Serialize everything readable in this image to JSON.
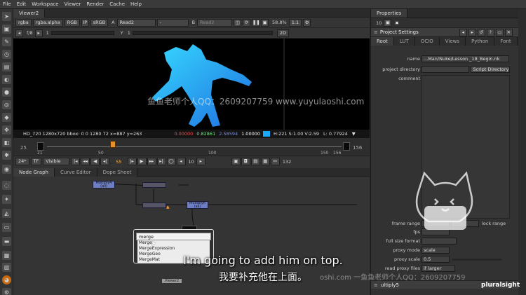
{
  "menubar": [
    "File",
    "Edit",
    "Workspace",
    "Viewer",
    "Render",
    "Cache",
    "Help"
  ],
  "viewer": {
    "tab": "Viewer2",
    "channels": "rgba",
    "channel_sel": "rgba.alpha",
    "colorspace_mode": "RGB",
    "ip": "IP",
    "lut": "sRGB",
    "input_a_label": "A",
    "input_a": "Read2",
    "input_mid": "-",
    "input_b_label": "B",
    "input_b": "Read2",
    "zoom": "58.8%",
    "ratio": "1:1",
    "fstop": "f/8",
    "gain": "1",
    "y_label": "Y",
    "gamma": "1",
    "view_mode": "2D",
    "info": "HD_720 1280x720  bbox: 0 0 1280 72  x=887 y=263",
    "pixel_r": "0.00000",
    "pixel_g": "0.82861",
    "pixel_b": "2.58594",
    "pixel_a": "1.00000",
    "hsv": "H:221 S:1.00 V:2.59",
    "lum": "L: 0.77924",
    "tl_start": "25",
    "tl_in": "21",
    "tl_mid": "50",
    "tl_100": "100",
    "tl_150": "150",
    "tl_156": "156",
    "tl_end": "156",
    "fps": "24*",
    "tf": "TF",
    "visible": "Visible",
    "frame": "55",
    "step": "10",
    "out_frame": "132"
  },
  "nodegraph": {
    "tabs": [
      "Node Graph",
      "Curve Editor",
      "Dope Sheet"
    ],
    "nodes": [
      {
        "name": "Multiply4",
        "sub": "(all)"
      },
      {
        "name": "Multiply6",
        "sub": "(all)"
      },
      {
        "name": "Viewer2"
      }
    ]
  },
  "popup": {
    "query": "merge",
    "items": [
      "Merge",
      "MergeExpression",
      "MergeGeo",
      "MergeMat"
    ]
  },
  "properties": {
    "title": "Properties",
    "max_panels": "10",
    "node_title": "Project Settings",
    "tabs": [
      "Root",
      "LUT",
      "OCIO",
      "Views",
      "Python",
      "Font"
    ],
    "name_label": "name",
    "name_value": "...Man/Nuke/Lesson _18_Begin.nk",
    "project_dir_label": "project directory",
    "script_dir_button": "Script Directory",
    "comment_label": "comment",
    "frame_range_label": "frame range",
    "lock_range": "lock range",
    "fps_label": "fps",
    "full_size_label": "full size format",
    "proxy_mode_label": "proxy mode",
    "proxy_mode_value": "scale",
    "proxy_scale_label": "proxy scale",
    "proxy_scale_value": "0.5",
    "read_proxy_label": "read proxy files",
    "read_proxy_value": "if larger",
    "bottom_node": "ultiply5"
  },
  "overlays": {
    "watermark_center": "鱼鱼老师个人QQ：2609207759  www.yuyulaoshi.com",
    "subtitle_en": "I'm going to add him on top.",
    "subtitle_zh": "我要补充他在上面。",
    "watermark_bottom": "oshi.com 一鱼鱼老师个人QQ：2609207759",
    "brand": "pluralsight"
  }
}
